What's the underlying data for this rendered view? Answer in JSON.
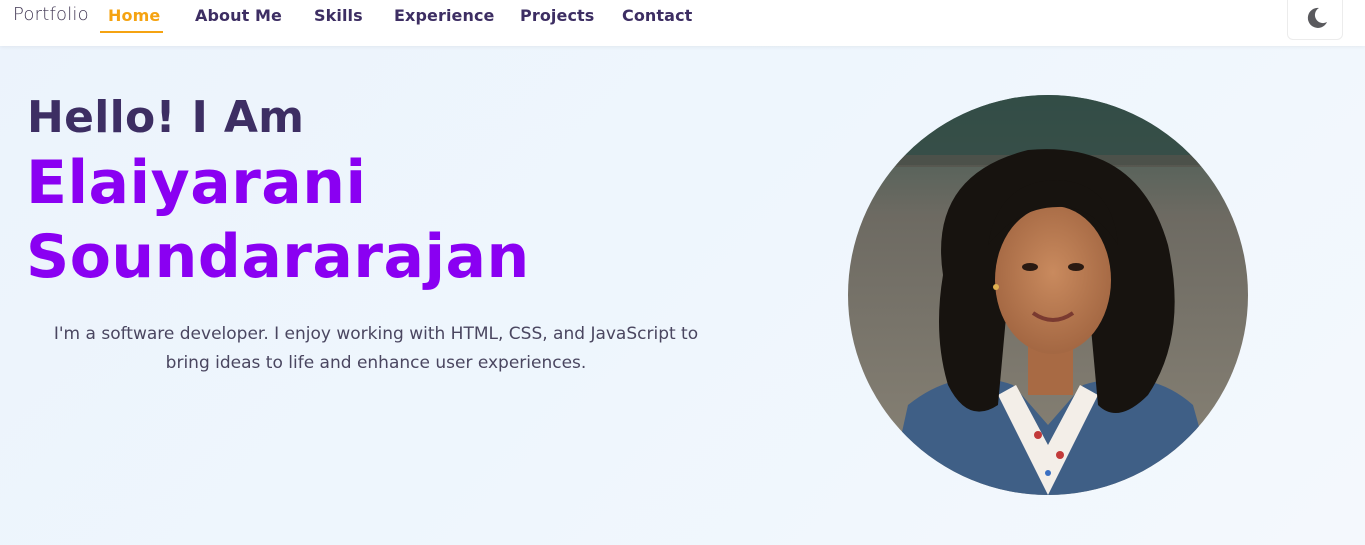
{
  "nav": {
    "brand": "Portfolio",
    "links": [
      "Home",
      "About Me",
      "Skills",
      "Experience",
      "Projects",
      "Contact"
    ],
    "active": "Home",
    "theme_toggle_icon": "moon-icon"
  },
  "hero": {
    "greeting": "Hello! I Am",
    "first_name": "Elaiyarani",
    "last_name": "Soundararajan",
    "intro_line1": "I'm a software developer. I enjoy working with HTML, CSS, and JavaScript to",
    "intro_line2": "bring ideas to life and enhance user experiences."
  },
  "colors": {
    "accent": "#f5a311",
    "name": "#8a00f2",
    "heading": "#3d2e63",
    "text": "#4a4660"
  }
}
